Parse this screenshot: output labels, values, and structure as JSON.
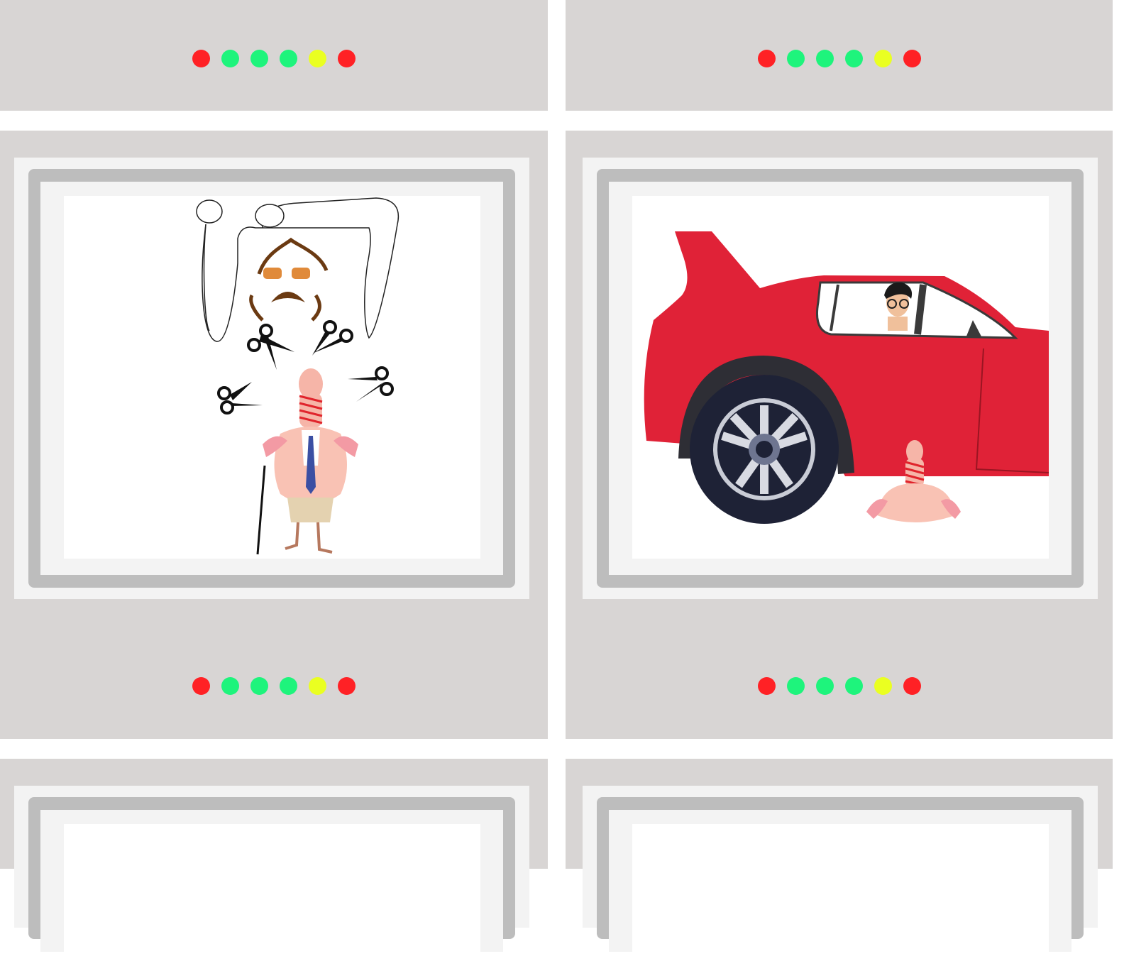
{
  "indicator_colors": [
    "#ff2125",
    "#1ef47c",
    "#1ef47c",
    "#1ef47c",
    "#eaff21",
    "#ff2125"
  ],
  "panels": [
    {
      "id": "top-left",
      "illustration": "none"
    },
    {
      "id": "top-right",
      "illustration": "none"
    },
    {
      "id": "middle-left",
      "illustration": "man-with-scissors-and-bound-figure"
    },
    {
      "id": "middle-right",
      "illustration": "red-car-with-driver-and-bound-figure"
    },
    {
      "id": "bottom-left",
      "illustration": "blank"
    },
    {
      "id": "bottom-right",
      "illustration": "blank"
    }
  ],
  "colors": {
    "panel_bg": "#d8d5d4",
    "frame": "#bdbdbd",
    "car_red": "#e02237",
    "skin_pink": "#f9c2b4",
    "tie_blue": "#3b4fa3"
  }
}
